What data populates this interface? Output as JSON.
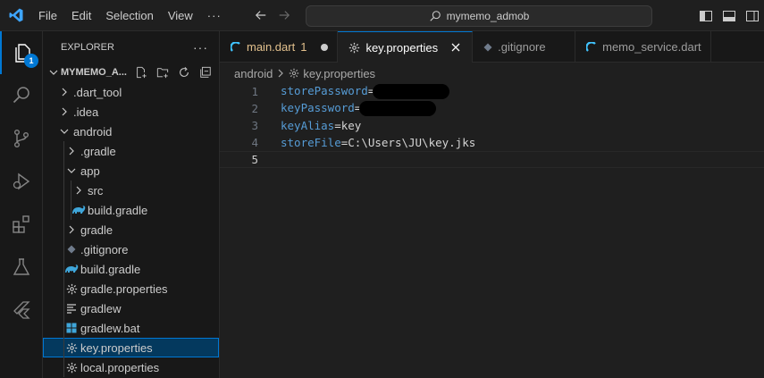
{
  "titlebar": {
    "menu": [
      "File",
      "Edit",
      "Selection",
      "View",
      "···"
    ],
    "search_text": "mymemo_admob"
  },
  "activity": {
    "explorer_badge": "1"
  },
  "sidebar": {
    "header": "EXPLORER",
    "project": "MYMEMO_A...",
    "tree": [
      {
        "label": ".dart_tool",
        "depth": 0,
        "kind": "folder-collapsed"
      },
      {
        "label": ".idea",
        "depth": 0,
        "kind": "folder-collapsed"
      },
      {
        "label": "android",
        "depth": 0,
        "kind": "folder-expanded"
      },
      {
        "label": ".gradle",
        "depth": 1,
        "kind": "folder-collapsed"
      },
      {
        "label": "app",
        "depth": 1,
        "kind": "folder-expanded"
      },
      {
        "label": "src",
        "depth": 2,
        "kind": "folder-collapsed"
      },
      {
        "label": "build.gradle",
        "depth": 2,
        "kind": "gradle"
      },
      {
        "label": "gradle",
        "depth": 1,
        "kind": "folder-collapsed"
      },
      {
        "label": ".gitignore",
        "depth": 1,
        "kind": "git"
      },
      {
        "label": "build.gradle",
        "depth": 1,
        "kind": "gradle"
      },
      {
        "label": "gradle.properties",
        "depth": 1,
        "kind": "gear"
      },
      {
        "label": "gradlew",
        "depth": 1,
        "kind": "lines"
      },
      {
        "label": "gradlew.bat",
        "depth": 1,
        "kind": "windows"
      },
      {
        "label": "key.properties",
        "depth": 1,
        "kind": "gear",
        "selected": true
      },
      {
        "label": "local.properties",
        "depth": 1,
        "kind": "gear"
      }
    ]
  },
  "tabs": [
    {
      "label": "main.dart",
      "modified": "1",
      "icon": "dart"
    },
    {
      "label": "key.properties",
      "active": true,
      "icon": "gear"
    },
    {
      "label": ".gitignore",
      "icon": "git"
    },
    {
      "label": "memo_service.dart",
      "icon": "dart"
    }
  ],
  "breadcrumb": {
    "folder": "android",
    "file": "key.properties"
  },
  "code": [
    {
      "n": "1",
      "key": "storePassword",
      "val": "",
      "redacted": true
    },
    {
      "n": "2",
      "key": "keyPassword",
      "val": "",
      "redacted": true
    },
    {
      "n": "3",
      "key": "keyAlias",
      "val": "key"
    },
    {
      "n": "4",
      "key": "storeFile",
      "val": "C:\\Users\\JU\\key.jks"
    },
    {
      "n": "5",
      "key": "",
      "val": "",
      "current": true
    }
  ],
  "colors": {
    "accent": "#0078d4",
    "key": "#569cd6",
    "modified": "#e2c08d",
    "dart": "#40c4ff"
  }
}
